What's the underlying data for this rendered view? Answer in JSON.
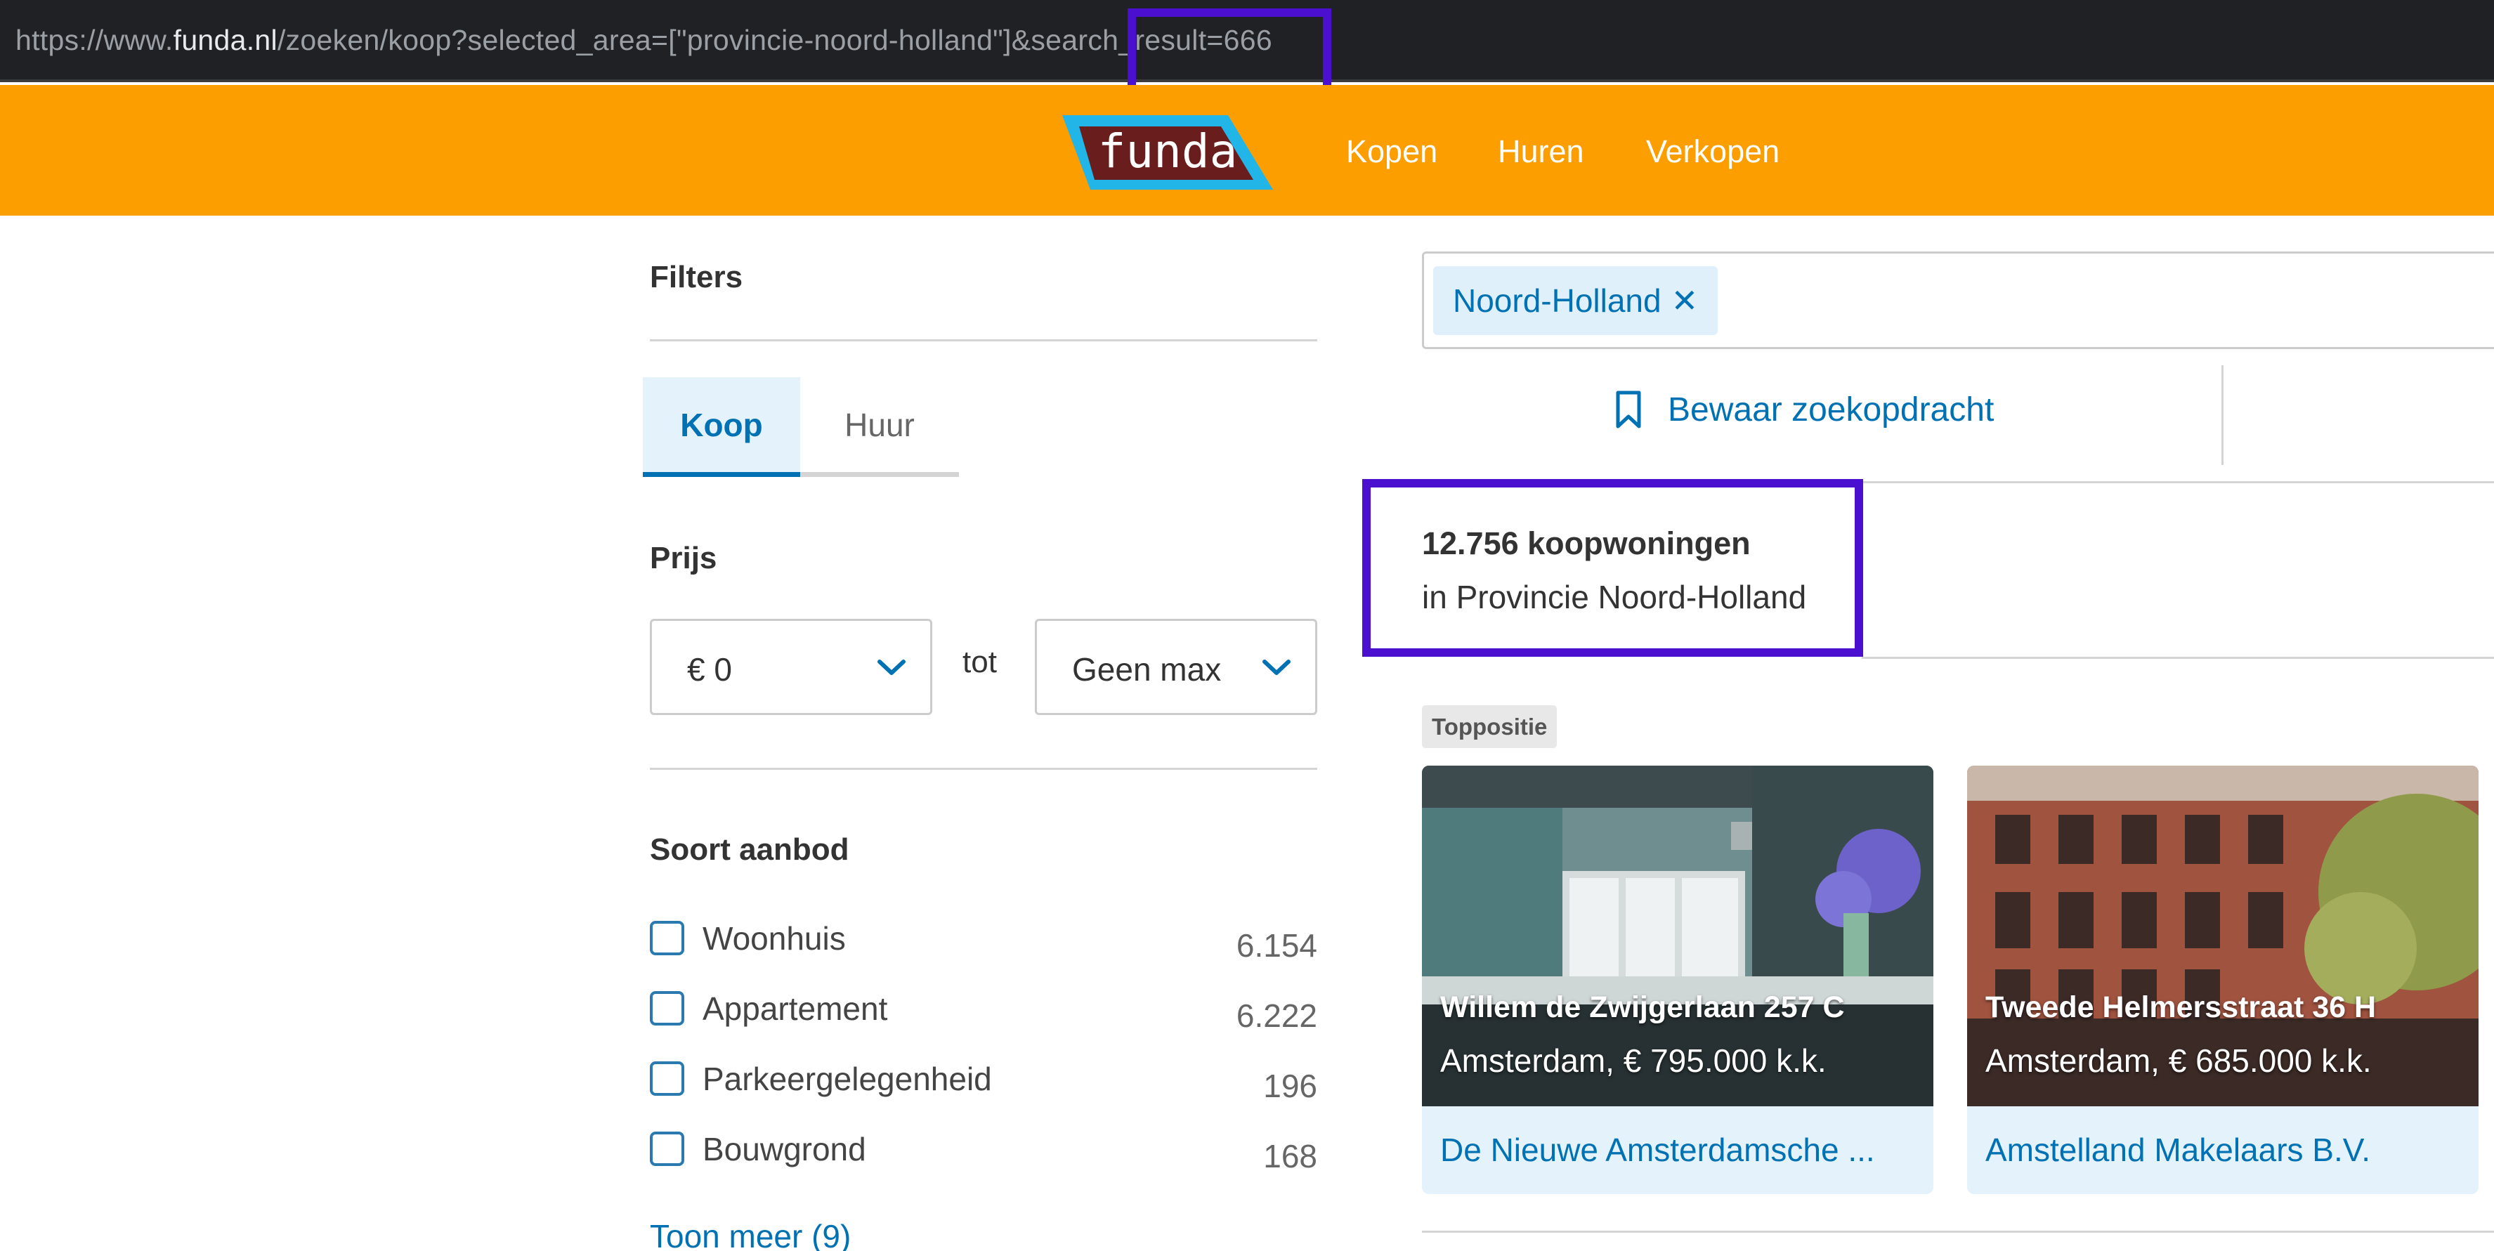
{
  "browser": {
    "url_prefix": "https://www.",
    "url_host": "funda.nl",
    "url_rest": "/zoeken/koop?selected_area=[\"provincie-noord-holland\"]&search_result=666"
  },
  "header": {
    "logo_text": "funda",
    "nav": [
      "Kopen",
      "Huren",
      "Verkopen"
    ],
    "colors": {
      "header_bg": "#fd9e00",
      "accent": "#0071b3",
      "highlight_box": "#4a0fcf"
    }
  },
  "filters": {
    "title": "Filters",
    "tabs": [
      "Koop",
      "Huur"
    ],
    "active_tab": "Koop",
    "price": {
      "title": "Prijs",
      "min": "€ 0",
      "separator": "tot",
      "max": "Geen max"
    },
    "soort_aanbod": {
      "title": "Soort aanbod",
      "items": [
        {
          "label": "Woonhuis",
          "count": "6.154"
        },
        {
          "label": "Appartement",
          "count": "6.222"
        },
        {
          "label": "Parkeergelegenheid",
          "count": "196"
        },
        {
          "label": "Bouwgrond",
          "count": "168"
        }
      ],
      "more": "Toon meer (9)"
    }
  },
  "search": {
    "chip": "Noord-Holland",
    "chip_close": "✕",
    "save_label": "Bewaar zoekopdracht"
  },
  "results": {
    "count": "12.756 koopwoningen",
    "place": "in Provincie Noord-Holland"
  },
  "promo": {
    "badge": "Toppositie",
    "cards": [
      {
        "title": "Willem de Zwijgerlaan 257 C",
        "subtitle": "Amsterdam, € 795.000 k.k.",
        "agent": "De Nieuwe Amsterdamsche ..."
      },
      {
        "title": "Tweede Helmersstraat 36 H",
        "subtitle": "Amsterdam, € 685.000 k.k.",
        "agent": "Amstelland Makelaars B.V."
      }
    ]
  }
}
